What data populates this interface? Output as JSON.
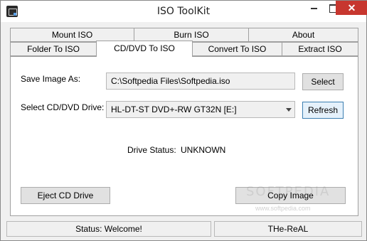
{
  "window": {
    "title": "ISO ToolKit"
  },
  "tabs": {
    "row1": [
      "Mount ISO",
      "Burn ISO",
      "About"
    ],
    "row2": [
      "Folder To ISO",
      "CD/DVD To ISO",
      "Convert To ISO",
      "Extract ISO"
    ],
    "active": "CD/DVD To ISO"
  },
  "form": {
    "save_label": "Save Image As:",
    "save_value": "C:\\Softpedia Files\\Softpedia.iso",
    "select_button": "Select",
    "drive_label": "Select CD/DVD Drive:",
    "drive_value": "HL-DT-ST DVD+-RW GT32N [E:]",
    "refresh_button": "Refresh",
    "status_label": "Drive Status:",
    "status_value": "UNKNOWN",
    "eject_button": "Eject CD Drive",
    "copy_button": "Copy Image"
  },
  "watermark": {
    "text": "SOFTPEDIA",
    "url": "www.softpedia.com"
  },
  "statusbar": {
    "status": "Status: Welcome!",
    "author": "THe-ReAL"
  }
}
